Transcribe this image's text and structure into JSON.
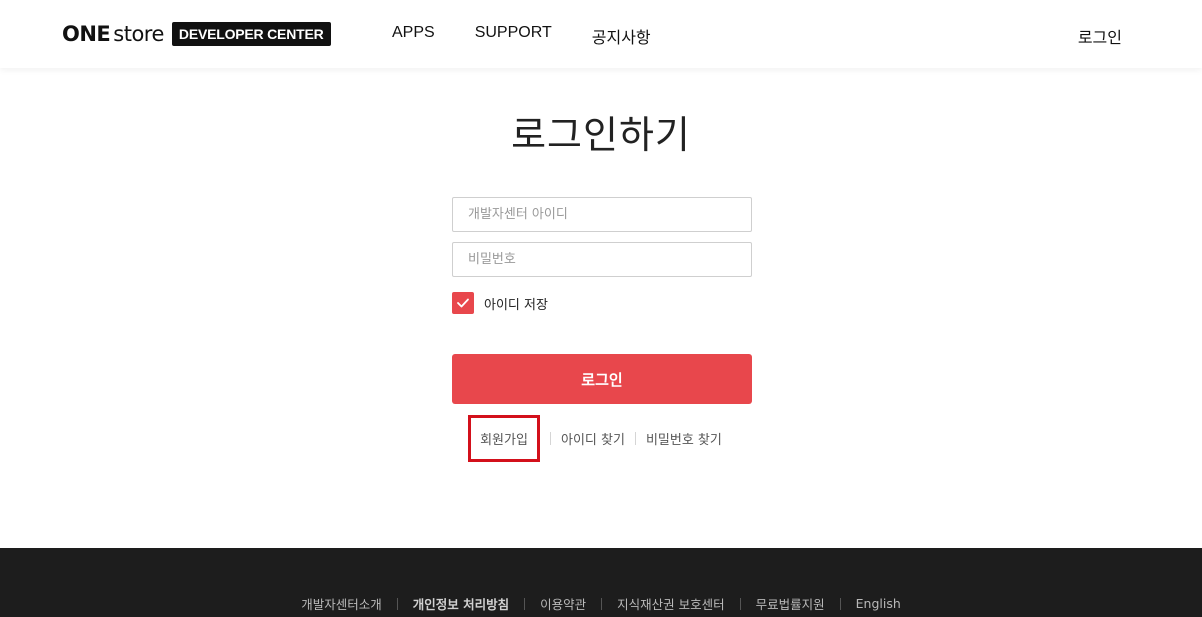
{
  "header": {
    "logo": {
      "one": "ONE",
      "store": "store",
      "badge": "DEVELOPER CENTER"
    },
    "nav": [
      "APPS",
      "SUPPORT",
      "공지사항"
    ],
    "login": "로그인"
  },
  "main": {
    "title": "로그인하기",
    "id_placeholder": "개발자센터 아이디",
    "pw_placeholder": "비밀번호",
    "remember_label": "아이디 저장",
    "remember_checked": true,
    "login_button": "로그인",
    "links": {
      "join": "회원가입",
      "find_id": "아이디 찾기",
      "find_pw": "비밀번호 찾기"
    }
  },
  "footer": {
    "links": [
      "개발자센터소개",
      "개인정보 처리방침",
      "이용약관",
      "지식재산권 보호센터",
      "무료법률지원",
      "English"
    ]
  },
  "colors": {
    "accent": "#e8474c",
    "highlight_box": "#d3101b",
    "footer_bg": "#1d1d1d"
  },
  "icons": {
    "checkbox": "check-icon"
  }
}
